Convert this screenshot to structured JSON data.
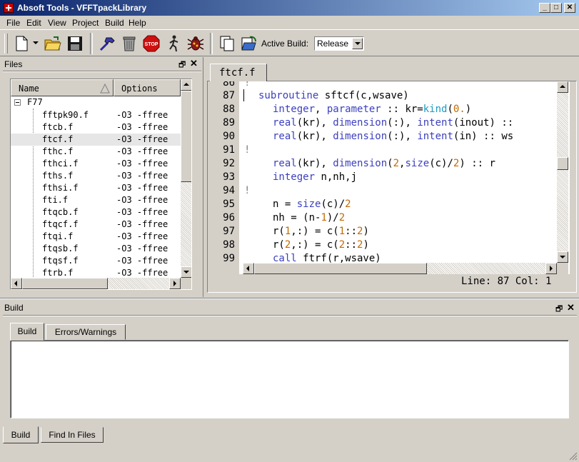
{
  "window": {
    "title": "Absoft Tools - VFFTpackLibrary",
    "buttons": [
      "_",
      "□",
      "✕"
    ]
  },
  "menu": [
    "File",
    "Edit",
    "View",
    "Project",
    "Build",
    "Help"
  ],
  "toolbar": {
    "buttons": [
      "new-file",
      "open-folder",
      "save",
      "build-hammer",
      "trash",
      "stop",
      "run",
      "debug"
    ],
    "stop_text": "STOP",
    "active_build_label": "Active Build:",
    "active_build_value": "Release"
  },
  "files_panel": {
    "title": "Files",
    "columns": [
      "Name",
      "Options"
    ],
    "root": "F77",
    "rows": [
      {
        "name": "fftpk90.f",
        "options": "-O3 -ffree"
      },
      {
        "name": "ftcb.f",
        "options": "-O3 -ffree"
      },
      {
        "name": "ftcf.f",
        "options": "-O3 -ffree"
      },
      {
        "name": "fthc.f",
        "options": "-O3 -ffree"
      },
      {
        "name": "fthci.f",
        "options": "-O3 -ffree"
      },
      {
        "name": "fths.f",
        "options": "-O3 -ffree"
      },
      {
        "name": "fthsi.f",
        "options": "-O3 -ffree"
      },
      {
        "name": "fti.f",
        "options": "-O3 -ffree"
      },
      {
        "name": "ftqcb.f",
        "options": "-O3 -ffree"
      },
      {
        "name": "ftqcf.f",
        "options": "-O3 -ffree"
      },
      {
        "name": "ftqi.f",
        "options": "-O3 -ffree"
      },
      {
        "name": "ftqsb.f",
        "options": "-O3 -ffree"
      },
      {
        "name": "ftqsf.f",
        "options": "-O3 -ffree"
      },
      {
        "name": "ftrb.f",
        "options": "-O3 -ffree"
      }
    ]
  },
  "editor": {
    "tab": "ftcf.f",
    "lines": [
      {
        "n": "86",
        "code": "!"
      },
      {
        "n": "87",
        "code": "subroutine sftcf(c,wsave)"
      },
      {
        "n": "88",
        "code": "  integer, parameter :: kr=kind(0.)"
      },
      {
        "n": "89",
        "code": "  real(kr), dimension(:), intent(inout) ::"
      },
      {
        "n": "90",
        "code": "  real(kr), dimension(:), intent(in) :: ws"
      },
      {
        "n": "91",
        "code": "!"
      },
      {
        "n": "92",
        "code": "  real(kr), dimension(2,size(c)/2) :: r"
      },
      {
        "n": "93",
        "code": "  integer n,nh,j"
      },
      {
        "n": "94",
        "code": "!"
      },
      {
        "n": "95",
        "code": "  n = size(c)/2"
      },
      {
        "n": "96",
        "code": "  nh = (n-1)/2"
      },
      {
        "n": "97",
        "code": "  r(1,:) = c(1::2)"
      },
      {
        "n": "98",
        "code": "  r(2,:) = c(2::2)"
      },
      {
        "n": "99",
        "code": "  call ftrf(r,wsave)"
      }
    ],
    "status": "Line: 87 Col: 1"
  },
  "build_panel": {
    "title": "Build",
    "tabs": [
      "Build",
      "Errors/Warnings"
    ],
    "bottom_tabs": [
      "Build",
      "Find In Files"
    ]
  }
}
